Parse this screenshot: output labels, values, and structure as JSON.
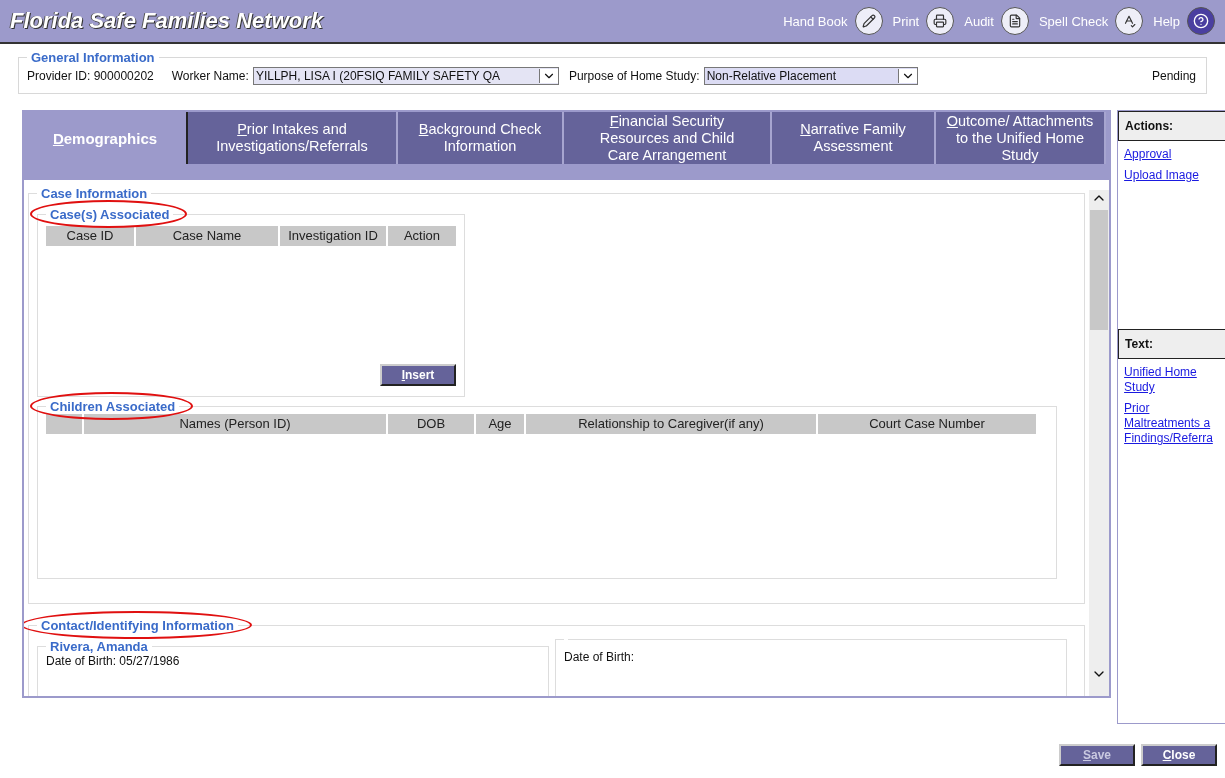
{
  "app": {
    "title": "Florida Safe Families Network"
  },
  "toolbar": [
    {
      "label": "Hand Book",
      "kind": "handbook"
    },
    {
      "label": "Print",
      "kind": "print"
    },
    {
      "label": "Audit",
      "kind": "audit"
    },
    {
      "label": "Spell Check",
      "kind": "spellcheck"
    },
    {
      "label": "Help",
      "kind": "help"
    }
  ],
  "general_information": {
    "legend": "General Information",
    "provider_id": "Provider ID: 900000202",
    "worker_name": {
      "label": "Worker Name:",
      "value": "YILLPH, LISA I (20FSIQ FAMILY SAFETY QA"
    },
    "purpose": {
      "label": "Purpose of Home Study:",
      "value": "Non-Relative Placement"
    },
    "status": "Pending"
  },
  "tabs": [
    {
      "lines": [
        "Demographics"
      ],
      "selected": true
    },
    {
      "lines": [
        "Prior Intakes and",
        "Investigations/Referrals"
      ],
      "selected": false
    },
    {
      "lines": [
        "Background Check",
        "Information"
      ],
      "selected": false
    },
    {
      "lines": [
        "Financial Security",
        "Resources and Child",
        "Care Arrangement"
      ],
      "selected": false
    },
    {
      "lines": [
        "Narrative Family",
        "Assessment"
      ],
      "selected": false
    },
    {
      "lines": [
        "Outcome/ Attachments",
        "to the Unified Home",
        "Study"
      ],
      "selected": false
    }
  ],
  "case_information": {
    "legend": "Case Information",
    "cases": {
      "legend": "Case(s) Associated",
      "highlighted": true,
      "columns": [
        "Case ID",
        "Case Name",
        "Investigation ID",
        "Action"
      ],
      "insert_button": "Insert"
    },
    "children": {
      "legend": "Children Associated",
      "highlighted": true,
      "columns": [
        "Names (Person ID)",
        "DOB",
        "Age",
        "Relationship to Caregiver(if any)",
        "Court Case Number"
      ]
    }
  },
  "contact": {
    "legend": "Contact/Identifying Information",
    "highlighted": true,
    "people": [
      {
        "name": "Rivera, Amanda",
        "date_of_birth": "Date of Birth: 05/27/1986"
      },
      {
        "date_of_birth": "Date of Birth:"
      }
    ]
  },
  "actions": {
    "title": "Actions:",
    "links": [
      "Approval",
      "Upload Image"
    ]
  },
  "text_panel": {
    "title": "Text:",
    "links": [
      {
        "lines": [
          "Unified Home",
          "Study"
        ]
      },
      {
        "lines": [
          "Prior",
          "Maltreatments a",
          "Findings/Referra"
        ]
      }
    ]
  },
  "buttons": [
    {
      "label": "Save",
      "disabled": true
    },
    {
      "label": "Close",
      "disabled": false
    }
  ]
}
